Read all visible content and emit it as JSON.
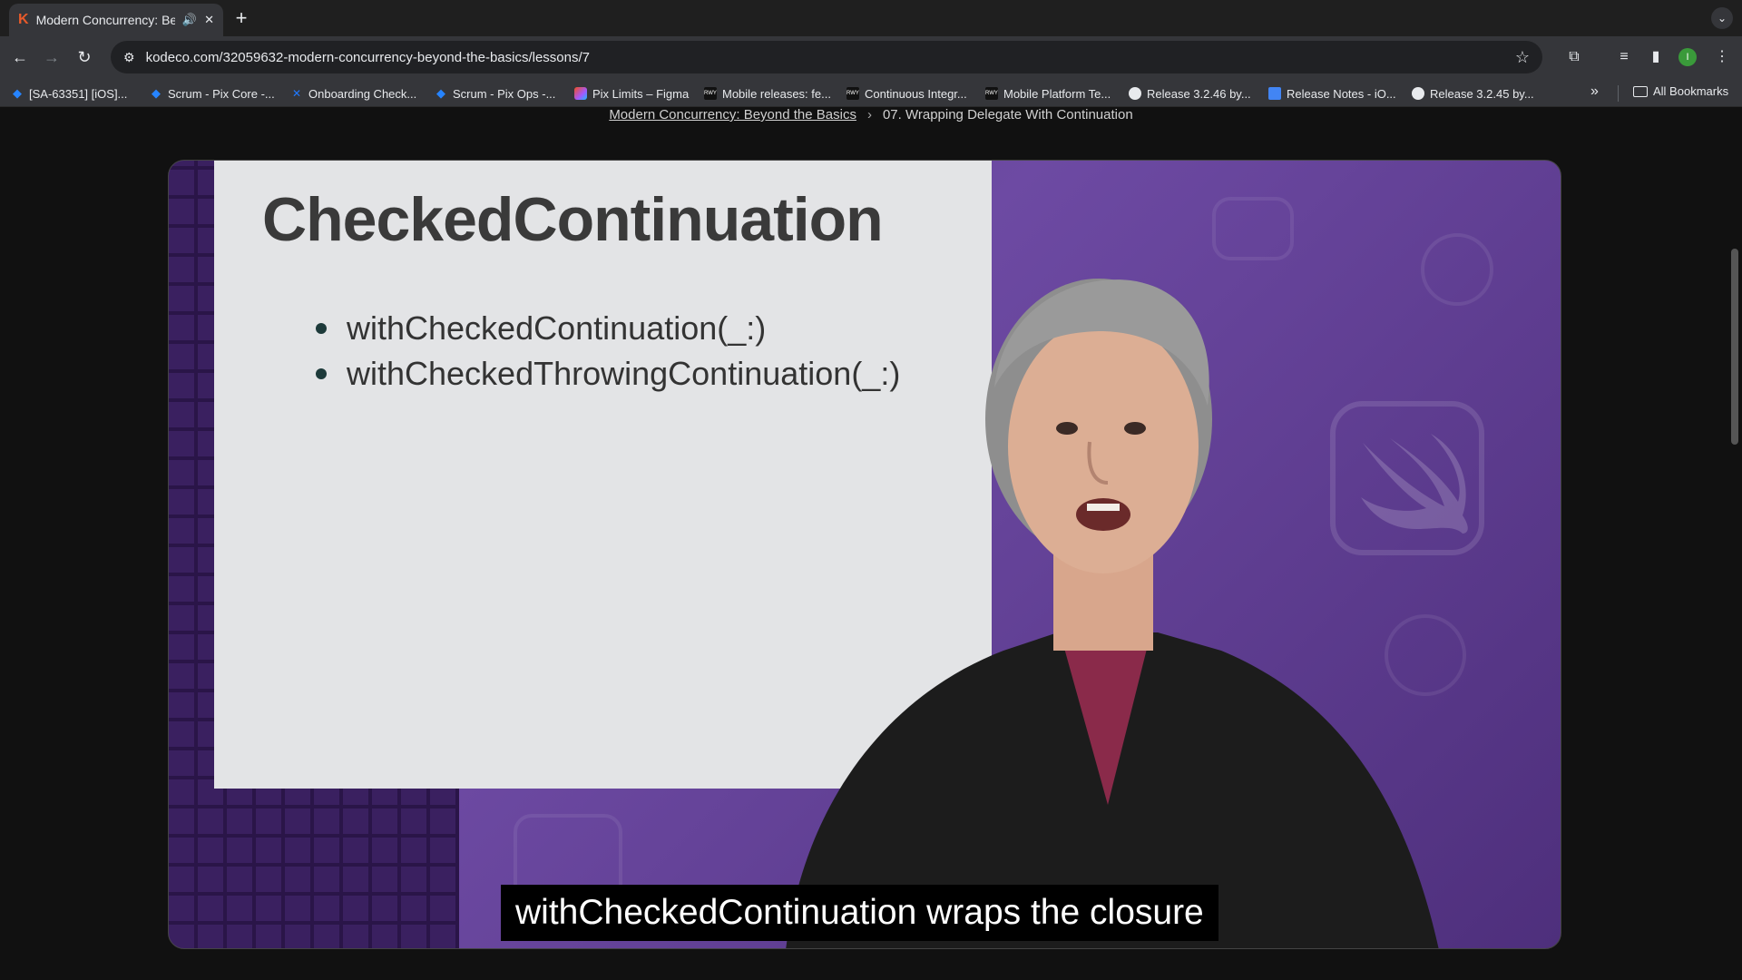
{
  "browser": {
    "tab": {
      "title": "Modern Concurrency: Beyond the Basics"
    },
    "url": "kodeco.com/32059632-modern-concurrency-beyond-the-basics/lessons/7",
    "profile_initial": "I",
    "bookmarks": [
      {
        "label": "[SA-63351] [iOS]...",
        "icon": "jira-icon"
      },
      {
        "label": "Scrum - Pix Core -...",
        "icon": "jira-icon"
      },
      {
        "label": "Onboarding Check...",
        "icon": "jira-icon"
      },
      {
        "label": "Scrum - Pix Ops -...",
        "icon": "jira-icon"
      },
      {
        "label": "Pix Limits – Figma",
        "icon": "figma-icon"
      },
      {
        "label": "Mobile releases: fe...",
        "icon": "rwy-icon"
      },
      {
        "label": "Continuous Integr...",
        "icon": "rwy-icon"
      },
      {
        "label": "Mobile Platform Te...",
        "icon": "rwy-icon"
      },
      {
        "label": "Release 3.2.46 by...",
        "icon": "github-icon"
      },
      {
        "label": "Release Notes - iO...",
        "icon": "docs-icon"
      },
      {
        "label": "Release 3.2.45 by...",
        "icon": "github-icon"
      }
    ],
    "all_bookmarks": "All Bookmarks"
  },
  "breadcrumb": {
    "course": "Modern Concurrency: Beyond the Basics",
    "lesson": "07. Wrapping Delegate With Continuation"
  },
  "video": {
    "slide_title": "CheckedContinuation",
    "bullets": [
      "withCheckedContinuation(_:)",
      "withCheckedThrowingContinuation(_:)"
    ],
    "caption": "withCheckedContinuation wraps the closure"
  }
}
